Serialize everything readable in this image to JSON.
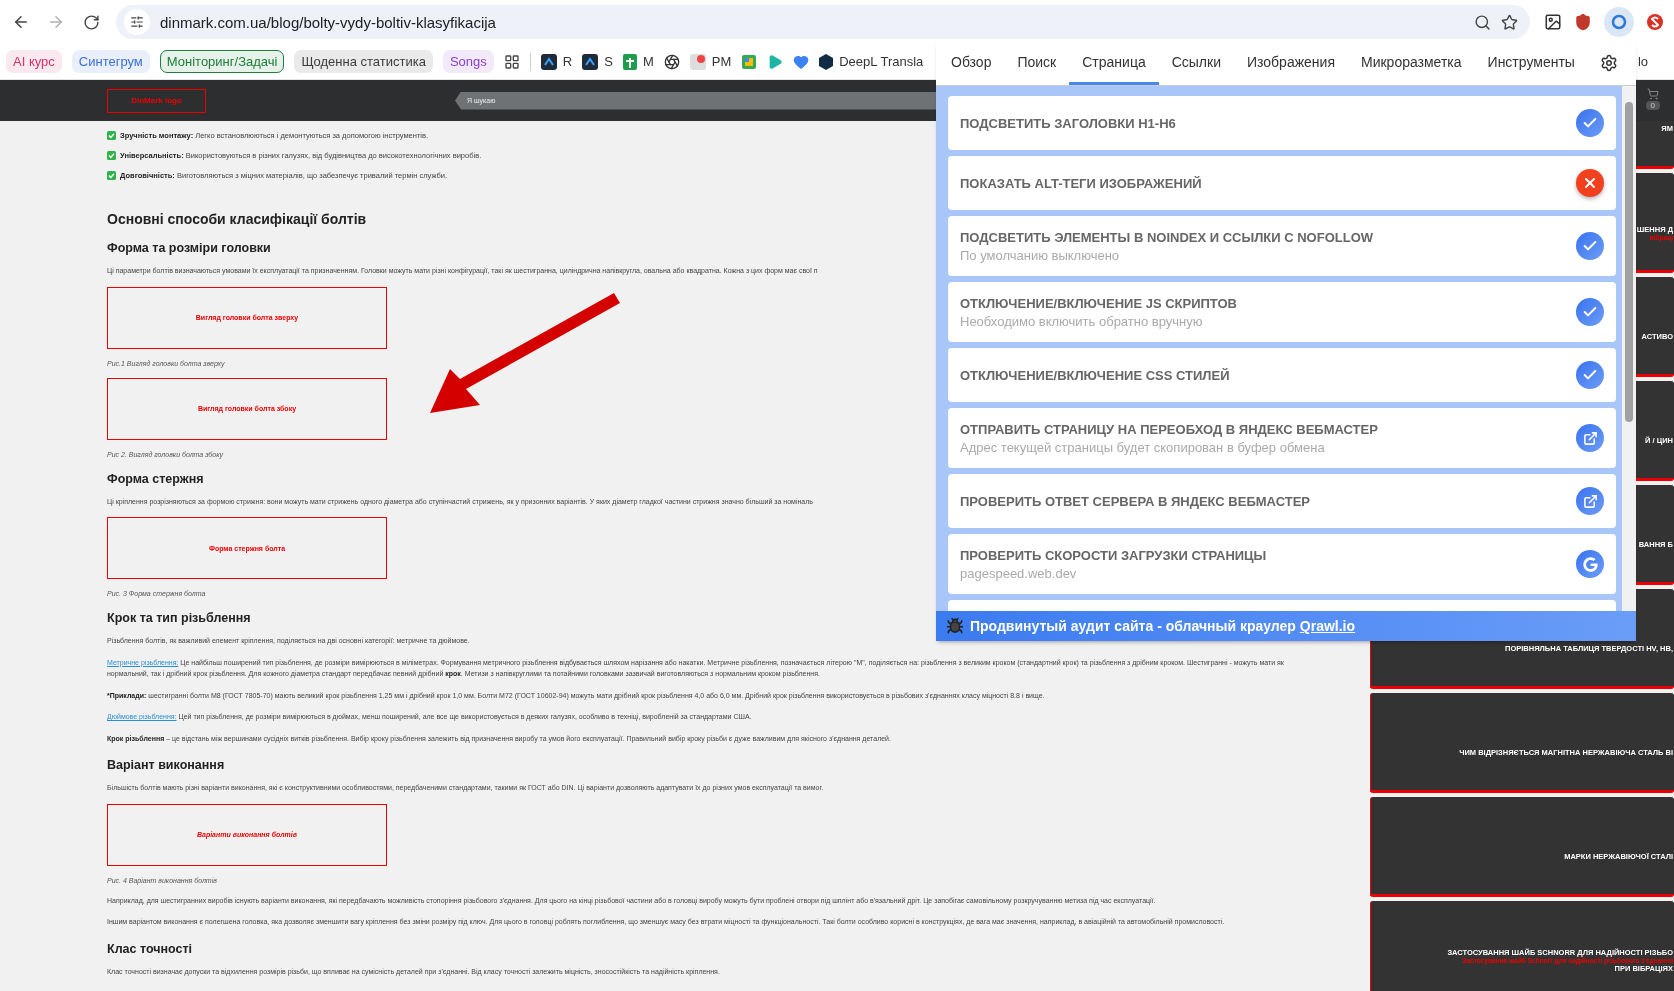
{
  "browser": {
    "url": "dinmark.com.ua/blog/bolty-vydy-boltiv-klasyfikacija"
  },
  "bookmarks": [
    {
      "kind": "chip",
      "label": "AI курс",
      "color": "#d6336c"
    },
    {
      "kind": "chip",
      "label": "Синтегрум",
      "color": "#3b6fd8"
    },
    {
      "kind": "chip-outlined",
      "label": "Моніторинг/Задачі",
      "color": "#1e7d3a"
    },
    {
      "kind": "chip",
      "label": "Щоденна статистика",
      "color": "#3c3c3c"
    },
    {
      "kind": "chip",
      "label": "Songs",
      "color": "#8a3fd1"
    },
    {
      "kind": "apps"
    },
    {
      "kind": "dark-logo",
      "label": "R"
    },
    {
      "kind": "dark-logo",
      "label": "S"
    },
    {
      "kind": "sheet",
      "label": "M"
    },
    {
      "kind": "knot"
    },
    {
      "kind": "pm",
      "label": "PM"
    },
    {
      "kind": "meet"
    },
    {
      "kind": "play"
    },
    {
      "kind": "heart"
    },
    {
      "kind": "deepl",
      "label": "DeepL Transla"
    },
    {
      "kind": "plain",
      "label": "lo"
    }
  ],
  "header": {
    "logo": "DinMark logo",
    "search_placeholder": "Я шукаю",
    "cart_count": "0"
  },
  "article": [
    {
      "kind": "check",
      "lead": "Зручність монтажу:",
      "text": "Легко встановлюються і демонтуються за допомогою інструментів."
    },
    {
      "kind": "check",
      "lead": "Універсальність:",
      "text": "Використовуються в різних галузях, від будівництва до високотехнологічних виробів."
    },
    {
      "kind": "check",
      "lead": "Довговічність:",
      "text": "Виготовляються з міцних матеріалів, що забезпечує тривалий термін служби."
    },
    {
      "kind": "h2",
      "text": "Основні способи класифікації болтів"
    },
    {
      "kind": "h3",
      "text": "Форма та розміри головки"
    },
    {
      "kind": "p",
      "text": "Ці параметри болтів визначаються умовами їх експлуатації та призначенням. Головки можуть мати різні конфігурації, такі як шестигранна, циліндрична напівкругла, овальна або квадратна. Кожна з цих форм має свої п"
    },
    {
      "kind": "figure",
      "alt": "Вигляд головки болта зверху",
      "caption": "Рис.1 Вигляд головки болта зверху",
      "italic": false
    },
    {
      "kind": "figure",
      "alt": "Вигляд головки болта збоку",
      "caption": "Рис 2. Вигляд головки болта збоку",
      "italic": false
    },
    {
      "kind": "h3",
      "text": "Форма стержня"
    },
    {
      "kind": "p",
      "text": "Ці кріплення розрізняються за формою стрижня: вони можуть мати стрижень одного діаметра або ступінчастий стрижень, як у призонних варіантів. У яких діаметр гладкої частини стрижня значно більший за номіналь"
    },
    {
      "kind": "figure",
      "alt": "Форма стержня болта",
      "caption": "Рис. 3 Форма стержня болта",
      "italic": false
    },
    {
      "kind": "h3",
      "text": "Крок та тип різьблення"
    },
    {
      "kind": "p",
      "text": "Різьблення болтів, як важливий елемент кріплення, поділяється на дві основні категорії: метричне та дюймове."
    },
    {
      "kind": "p",
      "link": "Метричне різьблення:",
      "text": " Це найбільш поширений тип різьблення, де розміри вимірюються в міліметрах. Формування метричного різьблення відбувається шляхом нарізання або накатки. Метричне різьблення, позначається літерою \"М\", поділяється на: різьблення з великим кроком (стандартний крок) та різьблення з дрібним кроком. Шестигранні - можуть мати як нормальний, так і дрібний крок різьблення. Для кожного діаметра стандарт передбачає певний дрібний **крок**. Метизи з напівкруглими та потайними головками зазвичай виготовляються з нормальним кроком різьблення."
    },
    {
      "kind": "p",
      "lead": "*Приклади:",
      "text": " шестигранні болти М8 (ГОСТ 7805-70) мають великий крок різьблення 1,25 мм і дрібний крок 1,0 мм. Болти М72 (ГОСТ 10602-94) можуть мати дрібний крок різьблення 4,0 або 6,0 мм. Дрібний крок різьблення використовується в різьбових з'єднаннях класу міцності 8.8 і вище."
    },
    {
      "kind": "p",
      "link": "Дюймове різьблення:",
      "text": " Цей тип різьблення, де розміри вимірюються в дюймах, менш поширений, але все ще використовується в деяких галузях, особливо в техніці, виробленій за стандартами США."
    },
    {
      "kind": "p",
      "lead": "Крок різьблення",
      "text": " – це відстань між вершинами сусідніх витків різьблення. Вибір кроку різьблення залежить від призначення виробу та умов його експлуатації. Правильний вибір кроку різьби є дуже важливим для якісного з'єднання деталей."
    },
    {
      "kind": "h3",
      "text": "Варіант виконання"
    },
    {
      "kind": "p",
      "text": "Більшість болтів мають різні варіанти виконання, які є конструктивними особливостями, передбаченими стандартами, такими як ГОСТ або DIN. Ці варіанти дозволяють адаптувати їх до різних умов експлуатації та вимог."
    },
    {
      "kind": "figure",
      "alt": "Варіанти виконання болтів",
      "caption": "Рис. 4 Варіант виконання болтів",
      "italic": true
    },
    {
      "kind": "p",
      "text": "Наприклад, для шестигранних виробів існують варіанти виконання, які передбачають можливість стопоріння різьбового з'єднання. Для цього на кінці різьбової частини або в головці виробу можуть бути проблені отвори під шплінт або в'язальний дріт. Це запобігає самовільному розкручуванню метиза під час експлуатації."
    },
    {
      "kind": "p",
      "text": "Іншим варіантом виконання є полегшена головка, яка дозволяє зменшити вагу кріплення без зміни розміру під ключ. Для цього в головці роблять поглиблення, що зменшує масу без втрати міцності та функціональності. Такі болти особливо корисні в конструкціях, де вага має значення, наприклад, в авіаційній та автомобільній промисловості."
    },
    {
      "kind": "h3",
      "text": "Клас точності"
    },
    {
      "kind": "p",
      "text": "Клас точності визначає допуски та відхилення розмірів різьби, що впливає на сумісність деталей при з'єднанні. Від класу точності залежить міцність, зносостійкість та надійність кріплення."
    }
  ],
  "sidebar_cards": [
    {
      "title": "ЯМ"
    },
    {
      "title": "ШЕННЯ Д",
      "subtitle": "вібраці"
    },
    {
      "title": "АСТИВО"
    },
    {
      "title": "Й / ЦИН"
    },
    {
      "title": "ВАННЯ Б"
    },
    {
      "title": "ПОРІВНЯЛЬНА ТАБЛИЦЯ ТВЕРДОСТІ HV, HB,"
    },
    {
      "title": "ЧИМ ВІДРІЗНЯЄТЬСЯ МАГНІТНА НЕРЖАВІЮЧА СТАЛЬ ВІ"
    },
    {
      "title": "МАРКИ НЕРЖАВІЮЧОЇ СТАЛІ"
    },
    {
      "title": "ЗАСТОСУВАННЯ ШАЙБ SCHNORR ДЛЯ НАДІЙНОСТІ РІЗЬБО",
      "subtitle": "Застосування шайб Schnorr для надійності різьбового з'єднання",
      "title_2": "ПРИ ВІБРАЦІЯХ"
    }
  ],
  "popup": {
    "tabs": [
      {
        "label": "Обзор",
        "selected": false
      },
      {
        "label": "Поиск",
        "selected": false
      },
      {
        "label": "Страница",
        "selected": true
      },
      {
        "label": "Ссылки",
        "selected": false
      },
      {
        "label": "Изображения",
        "selected": false
      },
      {
        "label": "Микроразметка",
        "selected": false
      },
      {
        "label": "Инструменты",
        "selected": false
      }
    ],
    "items": [
      {
        "kind": "toggle",
        "title": "ПОДСВЕТИТЬ ЗАГОЛОВКИ H1-H6",
        "on": true
      },
      {
        "kind": "toggle",
        "title": "ПОКАЗАТЬ ALT-ТЕГИ ИЗОБРАЖЕНИЙ",
        "on": false
      },
      {
        "kind": "toggle",
        "title": "ПОДСВЕТИТЬ ЭЛЕМЕНТЫ В NOINDEX И ССЫЛКИ С NOFOLLOW",
        "subtitle": "По умолчанию выключено",
        "on": true
      },
      {
        "kind": "toggle",
        "title": "ОТКЛЮЧЕНИЕ/ВКЛЮЧЕНИЕ JS СКРИПТОВ",
        "subtitle": "Необходимо включить обратно вручную",
        "on": true
      },
      {
        "kind": "toggle",
        "title": "ОТКЛЮЧЕНИЕ/ВКЛЮЧЕНИЕ CSS СТИЛЕЙ",
        "on": true
      },
      {
        "kind": "external",
        "title": "ОТПРАВИТЬ СТРАНИЦУ НА ПЕРЕОБХОД В ЯНДЕКС ВЕБМАСТЕР",
        "subtitle": "Адрес текущей страницы будет скопирован в буфер обмена"
      },
      {
        "kind": "external",
        "title": "ПРОВЕРИТЬ ОТВЕТ СЕРВЕРА В ЯНДЕКС ВЕБМАСТЕР"
      },
      {
        "kind": "pagespeed",
        "title": "ПРОВЕРИТЬ СКОРОСТИ ЗАГРУЗКИ СТРАНИЦЫ",
        "subtitle": "pagespeed.web.dev"
      }
    ],
    "footer": {
      "text": "Продвинутый аудит сайта - облачный краулер ",
      "link": "Qrawl.io"
    }
  }
}
